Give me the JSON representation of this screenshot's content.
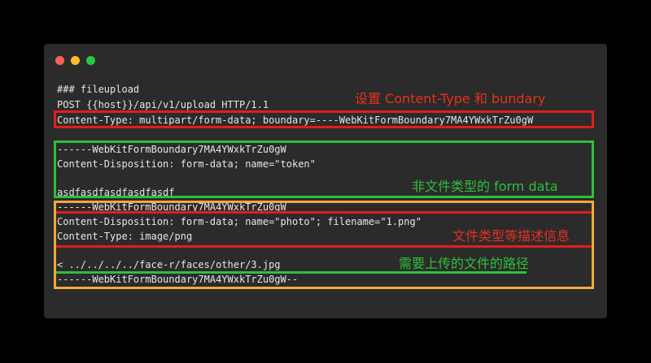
{
  "window": {
    "controls": [
      "close",
      "minimize",
      "zoom"
    ]
  },
  "code": {
    "lines": [
      "### fileupload",
      "POST {{host}}/api/v1/upload HTTP/1.1",
      "Content-Type: multipart/form-data; boundary=----WebKitFormBoundary7MA4YWxkTrZu0gW",
      "------WebKitFormBoundary7MA4YWxkTrZu0gW",
      "Content-Disposition: form-data; name=\"token\"",
      "asdfasdfasdfasdfasdf",
      "------WebKitFormBoundary7MA4YWxkTrZu0gW",
      "Content-Disposition: form-data; name=\"photo\"; filename=\"1.png\"",
      "Content-Type: image/png",
      "< ../../../../face-r/faces/other/3.jpg",
      "------WebKitFormBoundary7MA4YWxkTrZu0gW--"
    ]
  },
  "annotations": {
    "content_type": "设置 Content-Type 和 bundary",
    "form_data": "非文件类型的 form data",
    "file_type": "文件类型等描述信息",
    "file_path": "需要上传的文件的路径"
  },
  "colors": {
    "red": "#e01e1e",
    "green": "#2fbf3a",
    "orange": "#f2a93b",
    "window_bg": "#2b2b2b",
    "page_bg": "#000000"
  }
}
